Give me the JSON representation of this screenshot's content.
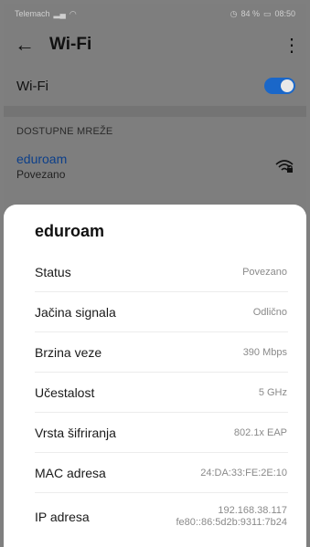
{
  "status_bar": {
    "carrier": "Telemach",
    "battery": "84 %",
    "time": "08:50"
  },
  "toolbar": {
    "back_icon": "←",
    "title": "Wi-Fi",
    "more_icon": "⋮"
  },
  "wifi_toggle": {
    "label": "Wi-Fi",
    "enabled": true
  },
  "available_networks": {
    "header": "DOSTUPNE MREŽE",
    "items": [
      {
        "name": "eduroam",
        "status": "Povezano",
        "icon": "wifi-lock-icon"
      }
    ]
  },
  "details_sheet": {
    "title": "eduroam",
    "rows": [
      {
        "label": "Status",
        "value": "Povezano"
      },
      {
        "label": "Jačina signala",
        "value": "Odlično"
      },
      {
        "label": "Brzina veze",
        "value": "390 Mbps"
      },
      {
        "label": "Učestalost",
        "value": "5 GHz"
      },
      {
        "label": "Vrsta šifriranja",
        "value": "802.1x EAP"
      },
      {
        "label": "MAC adresa",
        "value": "24:DA:33:FE:2E:10"
      },
      {
        "label": "IP adresa",
        "value": "192.168.38.117",
        "value2": "fe80::86:5d2b:9311:7b24"
      }
    ]
  },
  "colors": {
    "accent": "#1a67c9",
    "link": "#0c3f8a"
  }
}
